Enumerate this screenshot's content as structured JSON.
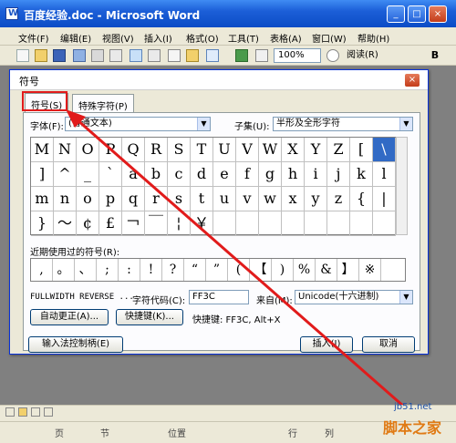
{
  "window": {
    "title": "百度经验.doc - Microsoft Word",
    "minimize": "_",
    "maximize": "□",
    "close": "×"
  },
  "menu": [
    "文件(F)",
    "编辑(E)",
    "视图(V)",
    "插入(I)",
    "格式(O)",
    "工具(T)",
    "表格(A)",
    "窗口(W)",
    "帮助(H)"
  ],
  "toolbar": {
    "zoom": "100%",
    "reading_label": "阅读(R)"
  },
  "dialog": {
    "title": "符号",
    "close": "×",
    "tabs": [
      "符号(S)",
      "特殊字符(P)"
    ],
    "font_label": "字体(F):",
    "font_value": "(普通文本)",
    "subset_label": "子集(U):",
    "subset_value": "半形及全形字符",
    "symbols": [
      [
        "M",
        "N",
        "O",
        "P",
        "Q",
        "R",
        "S",
        "T",
        "U",
        "V",
        "W",
        "X",
        "Y",
        "Z",
        "[",
        "\\"
      ],
      [
        "]",
        "^",
        "_",
        "`",
        "a",
        "b",
        "c",
        "d",
        "e",
        "f",
        "g",
        "h",
        "i",
        "j",
        "k",
        "l"
      ],
      [
        "m",
        "n",
        "o",
        "p",
        "q",
        "r",
        "s",
        "t",
        "u",
        "v",
        "w",
        "x",
        "y",
        "z",
        "{",
        "|"
      ],
      [
        "}",
        "～",
        "¢",
        "£",
        "￢",
        "￣",
        "¦",
        "￥",
        "",
        "",
        "",
        "",
        "",
        "",
        "",
        ""
      ]
    ],
    "selected_symbol": "\\",
    "recent_label": "近期使用过的符号(R):",
    "recent_symbols": [
      ",",
      "。",
      "、",
      ";",
      ":",
      "!",
      "?",
      "“",
      "”",
      "(",
      "【",
      ")",
      "%",
      "&",
      "】",
      "※"
    ],
    "char_name": "FULLWIDTH REVERSE ...",
    "code_label": "字符代码(C):",
    "code_value": "FF3C",
    "from_label": "来自(M):",
    "from_value": "Unicode(十六进制)",
    "autocorrect_button": "自动更正(A)...",
    "shortcut_button": "快捷键(K)...",
    "shortcut_text": "快捷键: FF3C, Alt+X",
    "ime_button": "输入法控制柄(E)",
    "insert_button": "插入(I)",
    "cancel_button": "取消"
  },
  "status": [
    "页",
    "节",
    "位置",
    "行",
    "列"
  ],
  "watermark": {
    "url": "jb51.net",
    "name": "脚本之家"
  },
  "colors": {
    "highlight": "#e11b1b",
    "selection": "#316ac5",
    "title_blue": "#0b4cc6"
  }
}
